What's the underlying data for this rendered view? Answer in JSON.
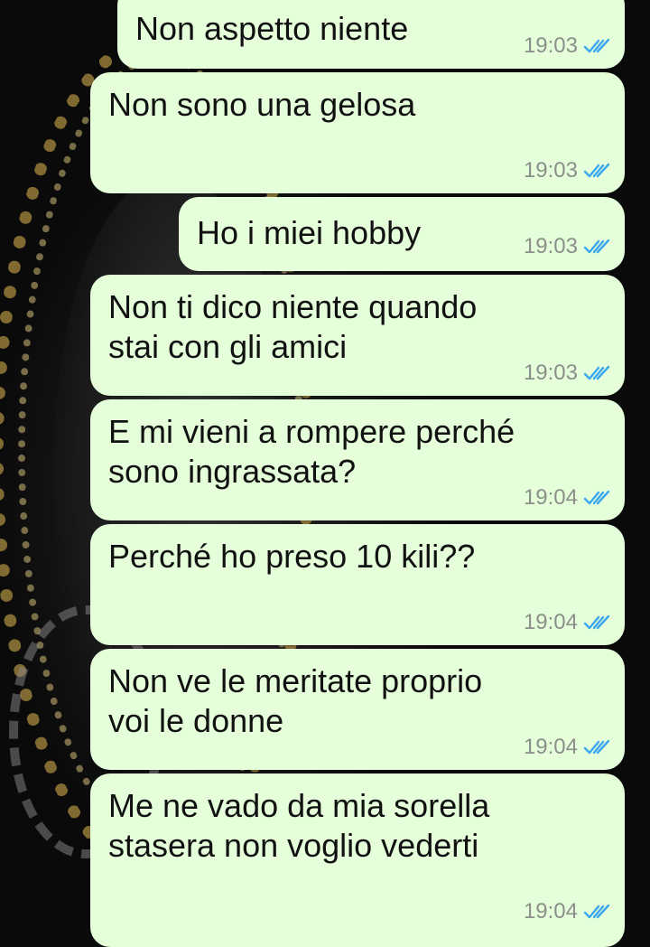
{
  "chat": {
    "messages": [
      {
        "text": "Non aspetto niente",
        "time": "19:03",
        "status_icon": "double-check-read-icon"
      },
      {
        "text": "Non sono una gelosa",
        "time": "19:03",
        "status_icon": "double-check-read-icon"
      },
      {
        "text": "Ho i miei hobby",
        "time": "19:03",
        "status_icon": "double-check-read-icon"
      },
      {
        "text": "Non ti dico niente quando\nstai con gli amici",
        "time": "19:03",
        "status_icon": "double-check-read-icon"
      },
      {
        "text": "E mi vieni a rompere perché\nsono ingrassata?",
        "time": "19:04",
        "status_icon": "double-check-read-icon"
      },
      {
        "text": "Perché ho preso 10 kili??",
        "time": "19:04",
        "status_icon": "double-check-read-icon"
      },
      {
        "text": "Non ve le meritate proprio\nvoi le donne",
        "time": "19:04",
        "status_icon": "double-check-read-icon"
      },
      {
        "text": "Me ne vado da mia sorella\nstasera non voglio vederti",
        "time": "19:04",
        "status_icon": "double-check-read-icon"
      }
    ]
  },
  "colors": {
    "bubble": "#e6ffdb",
    "text": "#111111",
    "time": "#8a8f8a",
    "read_ticks": "#3aa7f0"
  }
}
